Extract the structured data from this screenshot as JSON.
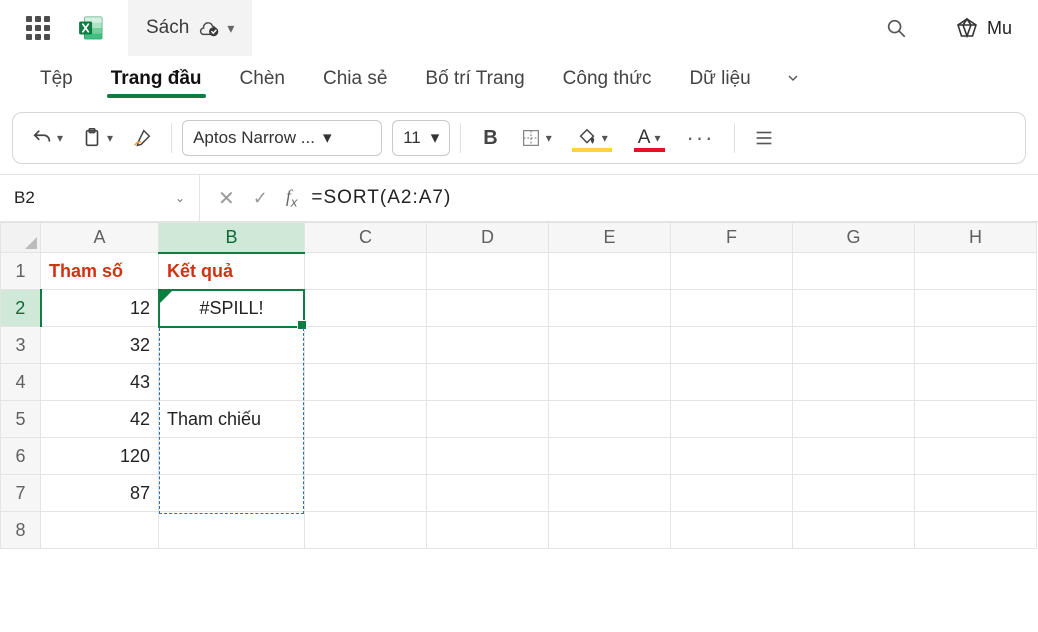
{
  "title": {
    "doc_name": "Sách",
    "premium_label": "Mu"
  },
  "ribbon": {
    "tabs": [
      "Tệp",
      "Trang đầu",
      "Chèn",
      "Chia sẻ",
      "Bố trí Trang",
      "Công thức",
      "Dữ liệu"
    ],
    "active_index": 1
  },
  "toolbar": {
    "font_name": "Aptos Narrow ...",
    "font_size": "11",
    "bold_label": "B"
  },
  "formula_bar": {
    "name_box": "B2",
    "formula": "=SORT(A2:A7)"
  },
  "grid": {
    "columns": [
      "A",
      "B",
      "C",
      "D",
      "E",
      "F",
      "G",
      "H"
    ],
    "row_count": 8,
    "selected_col": "B",
    "selected_row": 2,
    "headers": {
      "A1": "Tham số",
      "B1": "Kết quả"
    },
    "data": {
      "A2": "12",
      "A3": "32",
      "A4": "43",
      "A5": "42",
      "A6": "120",
      "A7": "87",
      "B2": "#SPILL!",
      "B5": "Tham chiếu"
    }
  }
}
